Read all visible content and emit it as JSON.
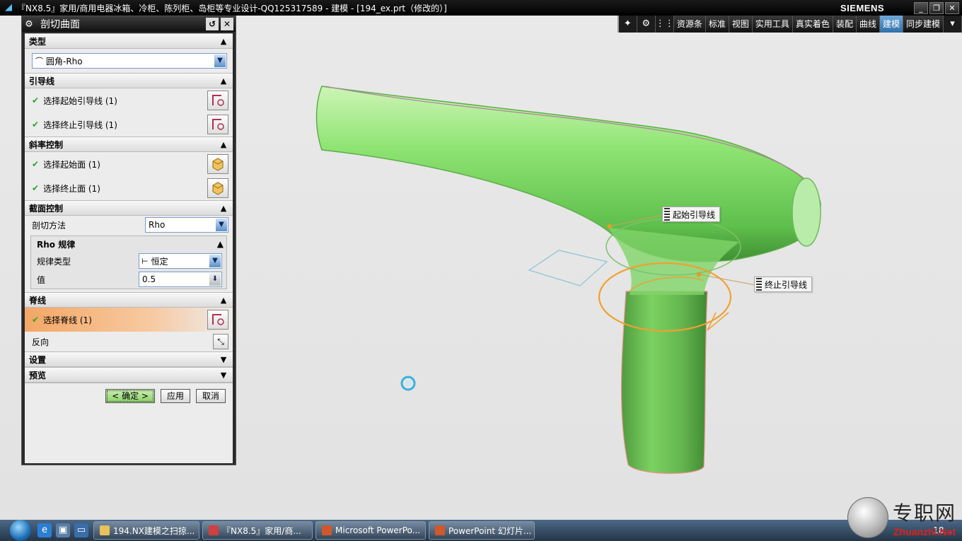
{
  "window": {
    "title": "『NX8.5』家用/商用电器冰箱、冷柜、陈列柜、岛柜等专业设计-QQ125317589 - 建模 - [194_ex.prt（修改的）]",
    "brand": "SIEMENS",
    "controls": [
      "_",
      "❐",
      "✕"
    ]
  },
  "toolbar": {
    "tabs": [
      {
        "label": "资源条",
        "active": false
      },
      {
        "label": "标准",
        "active": false
      },
      {
        "label": "视图",
        "active": false
      },
      {
        "label": "实用工具",
        "active": false
      },
      {
        "label": "真实着色",
        "active": false
      },
      {
        "label": "装配",
        "active": false
      },
      {
        "label": "曲线",
        "active": false
      },
      {
        "label": "建模",
        "active": true
      },
      {
        "label": "同步建模",
        "active": false
      }
    ]
  },
  "dialog": {
    "title": "剖切曲面",
    "sections": {
      "type": {
        "header": "类型",
        "value": "圆角-Rho"
      },
      "guides": {
        "header": "引导线",
        "start": "选择起始引导线 (1)",
        "end": "选择终止引导线 (1)"
      },
      "slope": {
        "header": "斜率控制",
        "start": "选择起始面 (1)",
        "end": "选择终止面 (1)"
      },
      "section": {
        "header": "截面控制",
        "method_label": "剖切方法",
        "method_value": "Rho",
        "rho": {
          "header": "Rho 规律",
          "law_label": "规律类型",
          "law_value": "恒定",
          "value_label": "值",
          "value": "0.5"
        }
      },
      "spine": {
        "header": "脊线",
        "select": "选择脊线 (1)",
        "reverse": "反向"
      },
      "settings": {
        "header": "设置"
      },
      "preview": {
        "header": "预览"
      }
    },
    "buttons": {
      "ok": "< 确定 >",
      "apply": "应用",
      "cancel": "取消"
    }
  },
  "viewport": {
    "labels": {
      "start_guide": "起始引导线",
      "end_guide": "终止引导线"
    }
  },
  "taskbar": {
    "tasks": [
      "194.NX建模之扫掠...",
      "『NX8.5』家用/商...",
      "Microsoft PowerPo...",
      "PowerPoint 幻灯片..."
    ],
    "clock": "18..."
  },
  "watermark": {
    "cn": "专职网",
    "en": "Zhuanzhi.Net"
  }
}
